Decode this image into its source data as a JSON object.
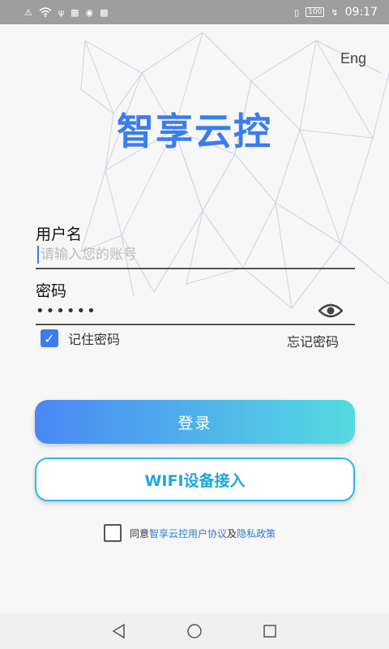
{
  "status_bar": {
    "battery": "100",
    "time": "09:17"
  },
  "header": {
    "language_toggle": "Eng",
    "app_title": "智享云控"
  },
  "form": {
    "username_label": "用户名",
    "username_placeholder": "请输入您的账号",
    "username_value": "",
    "password_label": "密码",
    "password_value": "••••••",
    "remember_label": "记住密码",
    "remember_checked": true,
    "forgot_label": "忘记密码"
  },
  "buttons": {
    "login": "登录",
    "wifi": "WIFI设备接入"
  },
  "agreement": {
    "checked": false,
    "prefix": "同意",
    "user_agreement": "智享云控用户协议",
    "and": "及",
    "privacy_policy": "隐私政策"
  },
  "colors": {
    "brand": "#3b7cf0",
    "gradient_start": "#4a87f4",
    "gradient_end": "#55dbe0",
    "wifi_border": "#2fb7e8",
    "link": "#2e7ad6"
  }
}
